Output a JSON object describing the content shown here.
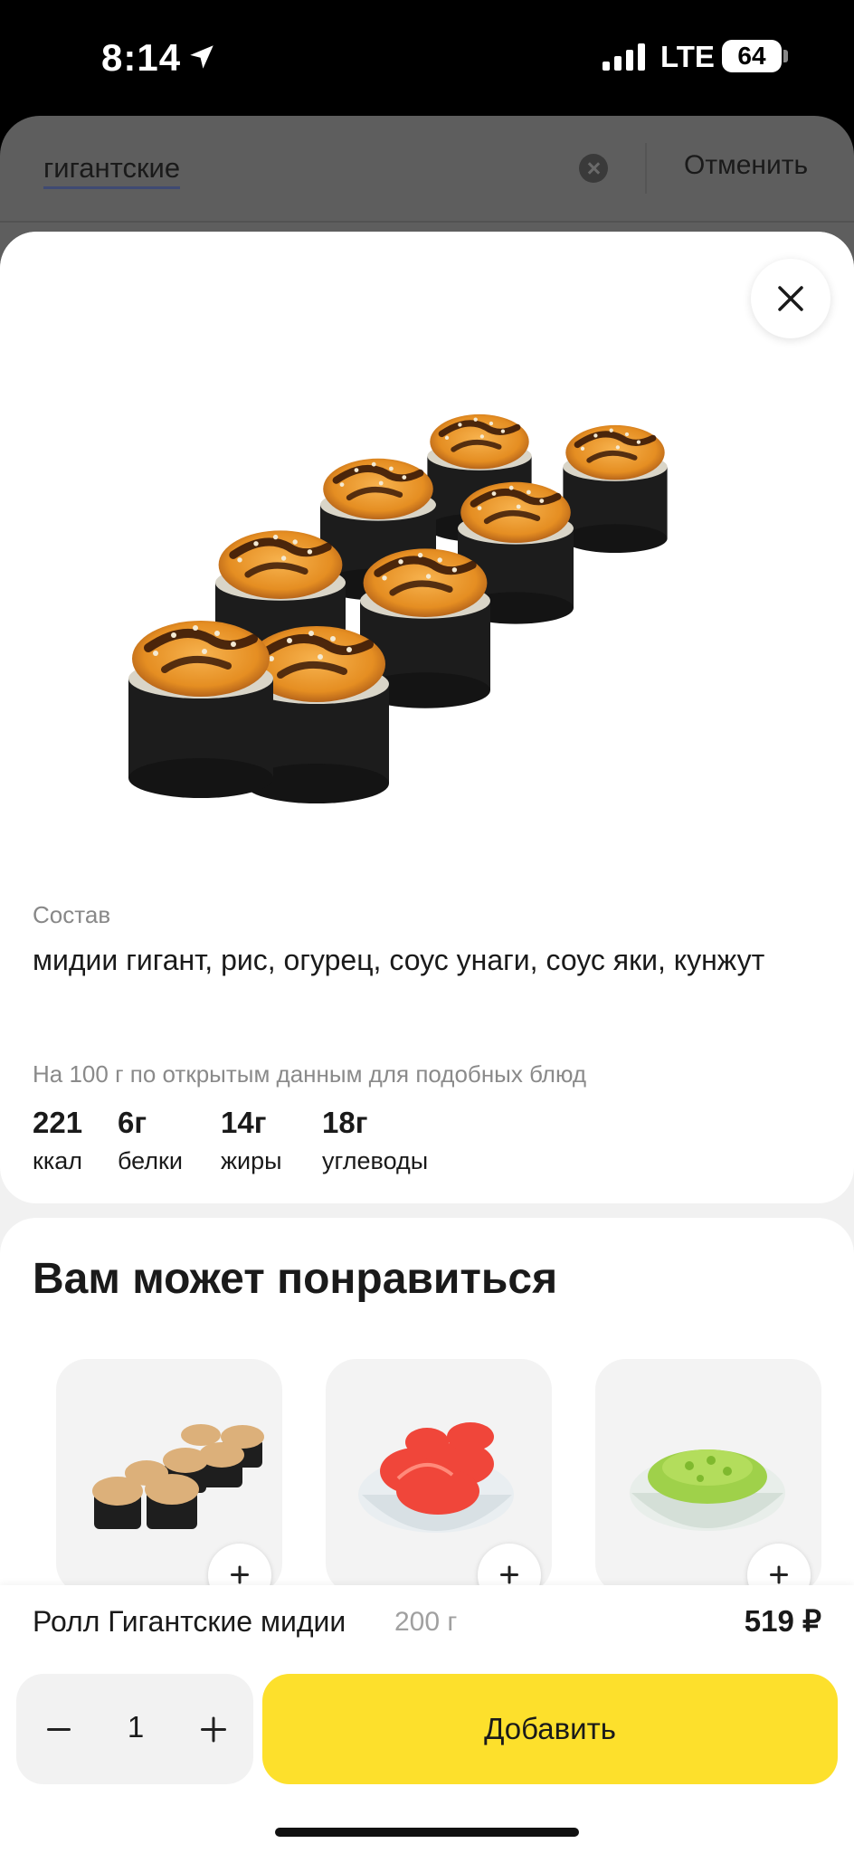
{
  "status_bar": {
    "time": "8:14",
    "network": "LTE",
    "battery": "64"
  },
  "search": {
    "query": "гигантские",
    "cancel_label": "Отменить"
  },
  "product": {
    "composition_label": "Состав",
    "composition": "мидии гигант, рис, огурец, соус унаги, соус яки, кунжут",
    "nutrition_note": "На 100 г по открытым данным для подобных блюд",
    "nutrition": [
      {
        "value": "221",
        "label": "ккал"
      },
      {
        "value": "6г",
        "label": "белки"
      },
      {
        "value": "14г",
        "label": "жиры"
      },
      {
        "value": "18г",
        "label": "углеводы"
      }
    ],
    "name": "Ролл Гигантские мидии",
    "weight": "200 г",
    "price": "519 ₽"
  },
  "recommendations": {
    "title": "Вам может понравиться",
    "items": [
      {
        "icon": "sushi-roll-image"
      },
      {
        "icon": "pickled-ginger-image"
      },
      {
        "icon": "wasabi-image"
      }
    ]
  },
  "order": {
    "quantity": "1",
    "add_label": "Добавить"
  },
  "colors": {
    "accent": "#fde02c",
    "text": "#1a1a1a",
    "muted": "#888888"
  }
}
